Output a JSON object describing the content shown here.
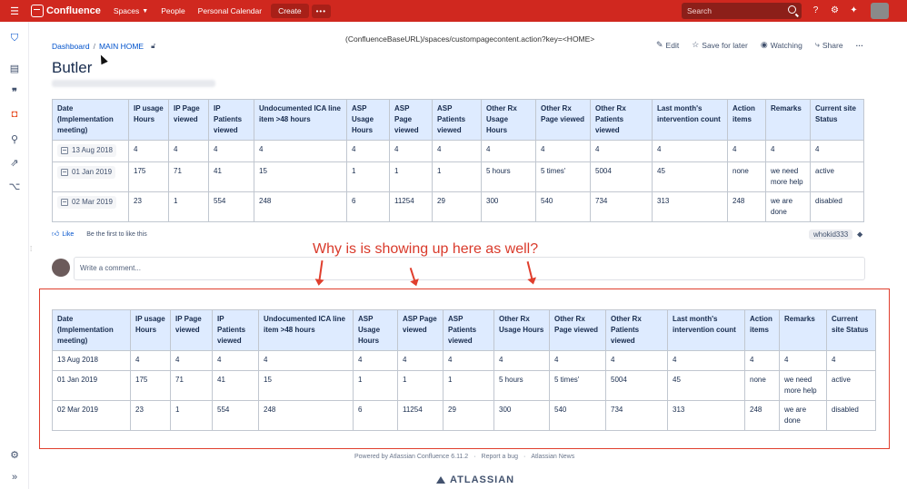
{
  "topbar": {
    "brand": "Confluence",
    "nav": [
      "Spaces",
      "People",
      "Personal Calendar"
    ],
    "create": "Create",
    "more": "•••",
    "search_placeholder": "Search"
  },
  "page": {
    "breadcrumb": [
      "Dashboard",
      "MAIN HOME"
    ],
    "url_text": "(ConfluenceBaseURL)/spaces/custompagecontent.action?key=<HOME>",
    "title": "Butler",
    "actions": [
      "Edit",
      "Save for later",
      "Watching",
      "Share"
    ]
  },
  "table_headers": [
    "Date (Implementation meeting)",
    "IP usage Hours",
    "IP Page viewed",
    "IP Patients viewed",
    "Undocumented ICA line item >48 hours",
    "ASP Usage Hours",
    "ASP Page viewed",
    "ASP Patients viewed",
    "Other Rx Usage Hours",
    "Other Rx Page viewed",
    "Other Rx Patients viewed",
    "Last month's intervention count",
    "Action items",
    "Remarks",
    "Current site Status"
  ],
  "table_rows": [
    [
      "13 Aug 2018",
      "4",
      "4",
      "4",
      "4",
      "4",
      "4",
      "4",
      "4",
      "4",
      "4",
      "4",
      "4",
      "4",
      "4"
    ],
    [
      "01 Jan 2019",
      "175",
      "71",
      "41",
      "15",
      "1",
      "1",
      "1",
      "5 hours",
      "5 times'",
      "5004",
      "45",
      "none",
      "we need more help",
      "active"
    ],
    [
      "02 Mar 2019",
      "23",
      "1",
      "554",
      "248",
      "6",
      "11254",
      "29",
      "300",
      "540",
      "734",
      "313",
      "248",
      "we are done",
      "disabled"
    ]
  ],
  "likes": {
    "like": "Like",
    "first": "Be the first to like this"
  },
  "label": "whokid333",
  "comment_placeholder": "Write a comment...",
  "annotation": "Why is is showing up here as well?",
  "footer": [
    "Powered by Atlassian Confluence 6.11.2",
    "·",
    "Report a bug",
    "·",
    "Atlassian News"
  ],
  "footer_brand": "ATLASSIAN",
  "colors": {
    "topbar": "#d0281f",
    "annotation": "#e03e2d",
    "header_bg": "#deebff"
  }
}
